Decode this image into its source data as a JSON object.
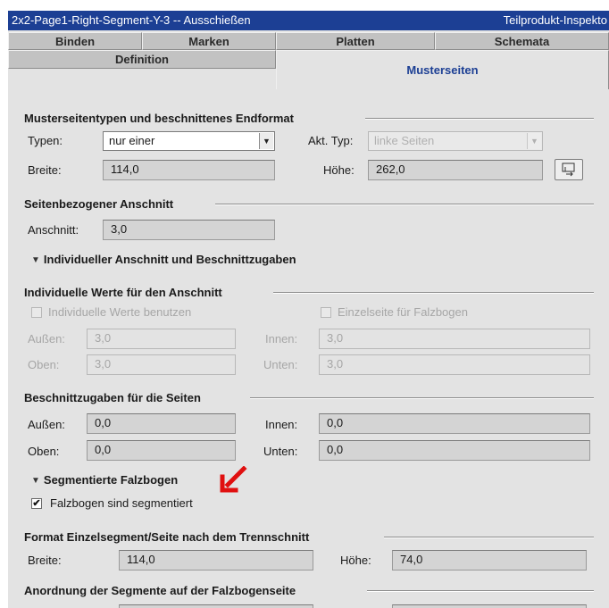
{
  "window": {
    "title": "2x2-Page1-Right-Segment-Y-3 -- Ausschießen",
    "right_title": "Teilprodukt-Inspekto"
  },
  "tabs": {
    "row1": [
      "Binden",
      "Marken",
      "Platten",
      "Schemata"
    ],
    "row2": [
      "Definition",
      "Musterseiten"
    ],
    "active": "Musterseiten"
  },
  "musterseiten": {
    "heading": "Musterseitentypen und beschnittenes Endformat",
    "typen_label": "Typen:",
    "typen_value": "nur einer",
    "akt_typ_label": "Akt. Typ:",
    "akt_typ_value": "linke Seiten",
    "breite_label": "Breite:",
    "breite_value": "114,0",
    "hoehe_label": "Höhe:",
    "hoehe_value": "262,0"
  },
  "seitenbezogen": {
    "heading": "Seitenbezogener Anschnitt",
    "anschnitt_label": "Anschnitt:",
    "anschnitt_value": "3,0"
  },
  "individuell_toggle": "Individueller Anschnitt und Beschnittzugaben",
  "individuelle_werte": {
    "heading": "Individuelle Werte für den Anschnitt",
    "cb1_label": "Individuelle Werte benutzen",
    "cb2_label": "Einzelseite für Falzbogen",
    "aussen_label": "Außen:",
    "aussen_value": "3,0",
    "innen_label": "Innen:",
    "innen_value": "3,0",
    "oben_label": "Oben:",
    "oben_value": "3,0",
    "unten_label": "Unten:",
    "unten_value": "3,0"
  },
  "beschnittzugaben": {
    "heading": "Beschnittzugaben für die Seiten",
    "aussen_label": "Außen:",
    "aussen_value": "0,0",
    "innen_label": "Innen:",
    "innen_value": "0,0",
    "oben_label": "Oben:",
    "oben_value": "0,0",
    "unten_label": "Unten:",
    "unten_value": "0,0"
  },
  "segmentiert": {
    "toggle": "Segmentierte Falzbogen",
    "checkbox_label": "Falzbogen sind segmentiert",
    "checked": true
  },
  "format_einzelsegment": {
    "heading": "Format Einzelsegment/Seite nach dem Trennschnitt",
    "breite_label": "Breite:",
    "breite_value": "114,0",
    "hoehe_label": "Höhe:",
    "hoehe_value": "74,0"
  },
  "anordnung": {
    "heading": "Anordnung der Segmente auf der Falzbogenseite"
  },
  "colors": {
    "titlebar": "#1c3f94",
    "panel": "#e3e3e3",
    "active_tab_text": "#1c3f94",
    "annotation_arrow": "#e01010"
  },
  "icons": {
    "combo_arrow": "chevron-down-icon",
    "swap_button": "swap-dimensions-icon",
    "disclosure": "triangle-down-icon",
    "annotation": "red-arrow-icon"
  }
}
